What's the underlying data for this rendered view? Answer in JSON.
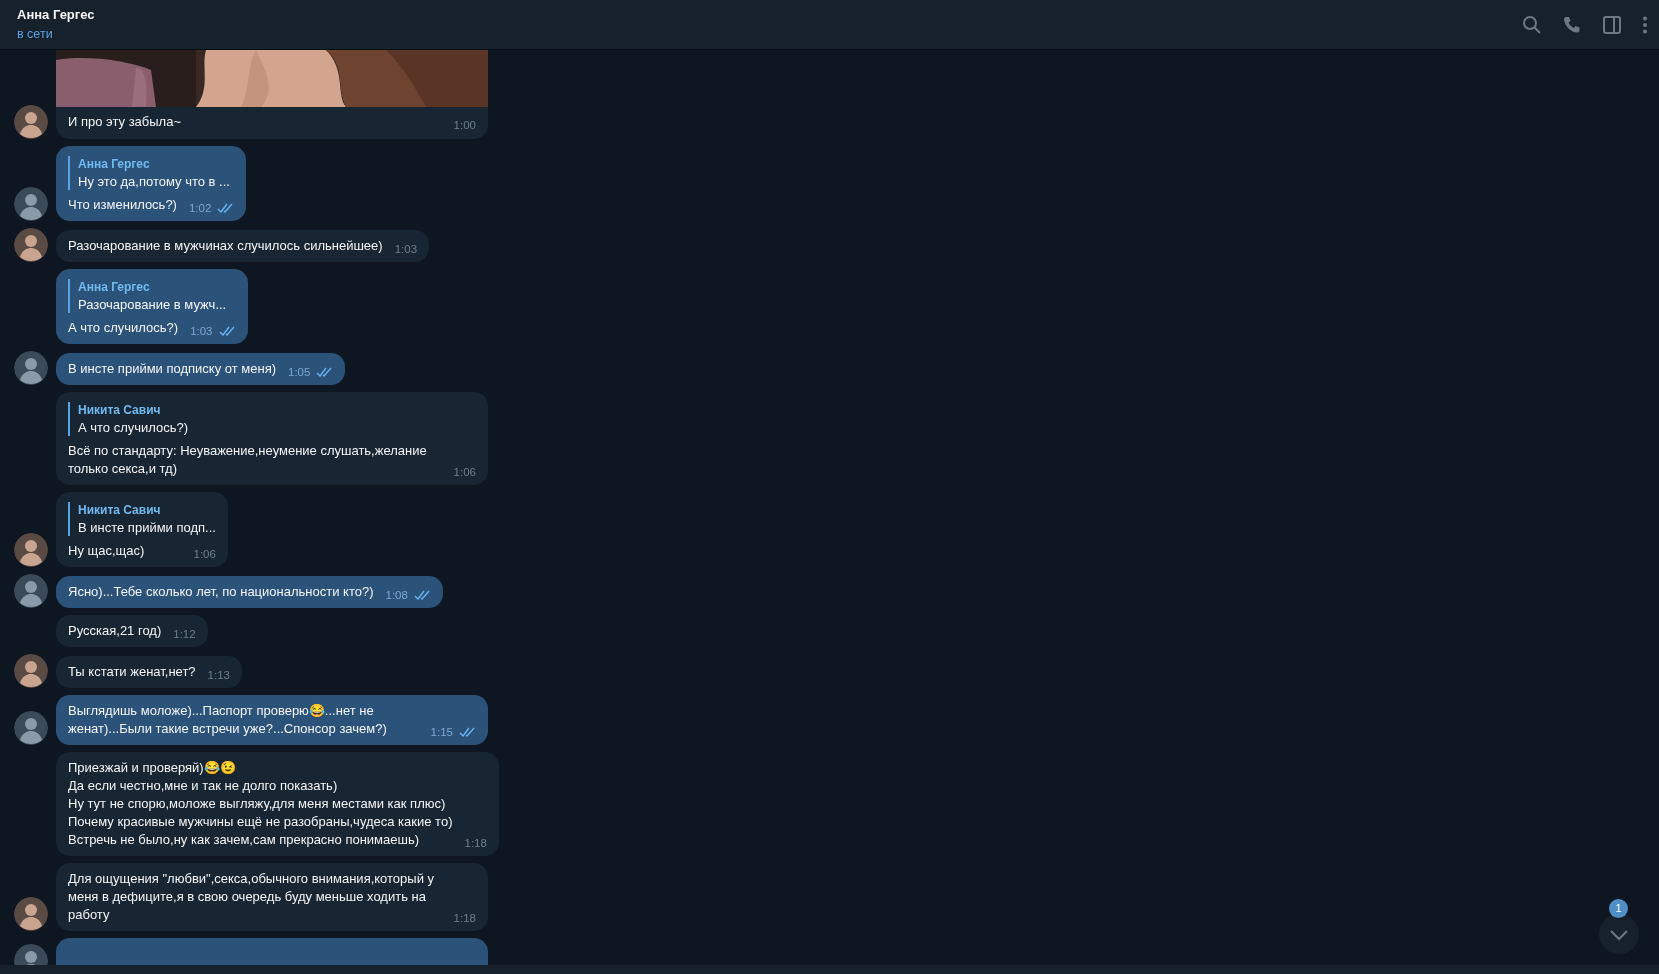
{
  "header": {
    "title": "Анна Гергес",
    "status": "в сети"
  },
  "messages": [
    {
      "outgoing": false,
      "avatar": true,
      "text": "И про эту забыла~",
      "time": "1:00"
    },
    {
      "kind": "text",
      "outgoing": true,
      "avatar": true,
      "read": true,
      "reply": {
        "name": "Анна Гергес",
        "text": "Ну это да,потому что в ..."
      },
      "text": "Что изменилось?)",
      "time": "1:02"
    },
    {
      "kind": "text",
      "outgoing": false,
      "avatar": true,
      "text": "Разочарование в мужчинах случилось сильнейшее)",
      "time": "1:03"
    },
    {
      "kind": "text",
      "outgoing": true,
      "avatar": false,
      "read": true,
      "reply": {
        "name": "Анна Гергес",
        "text": "Разочарование в мужч..."
      },
      "text": "А что случилось?)",
      "time": "1:03"
    },
    {
      "kind": "text",
      "outgoing": true,
      "avatar": true,
      "read": true,
      "text": "В инсте прийми подписку от меня)",
      "time": "1:05"
    },
    {
      "kind": "text",
      "outgoing": false,
      "avatar": false,
      "wide": true,
      "reply": {
        "name": "Никита Савич",
        "text": "А что случилось?)"
      },
      "text": "Всё по стандарту: Неуважение,неумение слушать,желание\nтолько секса,и тд)",
      "time": "1:06"
    },
    {
      "kind": "text",
      "outgoing": false,
      "avatar": true,
      "reply": {
        "name": "Никита Савич",
        "text": "В инсте прийми подп..."
      },
      "text": "Ну щас,щас)",
      "time": "1:06"
    },
    {
      "kind": "text",
      "outgoing": true,
      "avatar": true,
      "read": true,
      "text": "Ясно)...Тебе сколько лет, по национальности кто?)",
      "time": "1:08"
    },
    {
      "kind": "text",
      "outgoing": false,
      "avatar": false,
      "text": "Русская,21 год)",
      "time": "1:12"
    },
    {
      "kind": "text",
      "outgoing": false,
      "avatar": true,
      "text": "Ты кстати женат,нет?",
      "time": "1:13"
    },
    {
      "kind": "text",
      "outgoing": true,
      "avatar": true,
      "read": true,
      "wide": true,
      "text": "Выглядишь моложе)...Паспорт проверю😂...нет не\nженат)...Были такие встречи уже?...Спонсор зачем?)",
      "time": "1:15"
    },
    {
      "kind": "text",
      "outgoing": false,
      "avatar": false,
      "wide": true,
      "text": "Приезжай и проверяй)😂😉\nДа если честно,мне и так не долго показать)\nНу тут не спорю,моложе выгляжу,для меня местами как плюс)\nПочему красивые мужчины ещё не разобраны,чудеса какие то)\nВстречь не было,ну как зачем,сам прекрасно понимаешь)",
      "time": "1:18"
    },
    {
      "kind": "text",
      "outgoing": false,
      "avatar": true,
      "wide": true,
      "text": "Для ощущения \"любви\",секса,обычного внимания,который у\nменя в дефиците,я в свою очередь буду меньше ходить на\nработу",
      "time": "1:18"
    },
    {
      "kind": "cut",
      "outgoing": true,
      "avatar": true
    }
  ],
  "unread_badge": "1"
}
